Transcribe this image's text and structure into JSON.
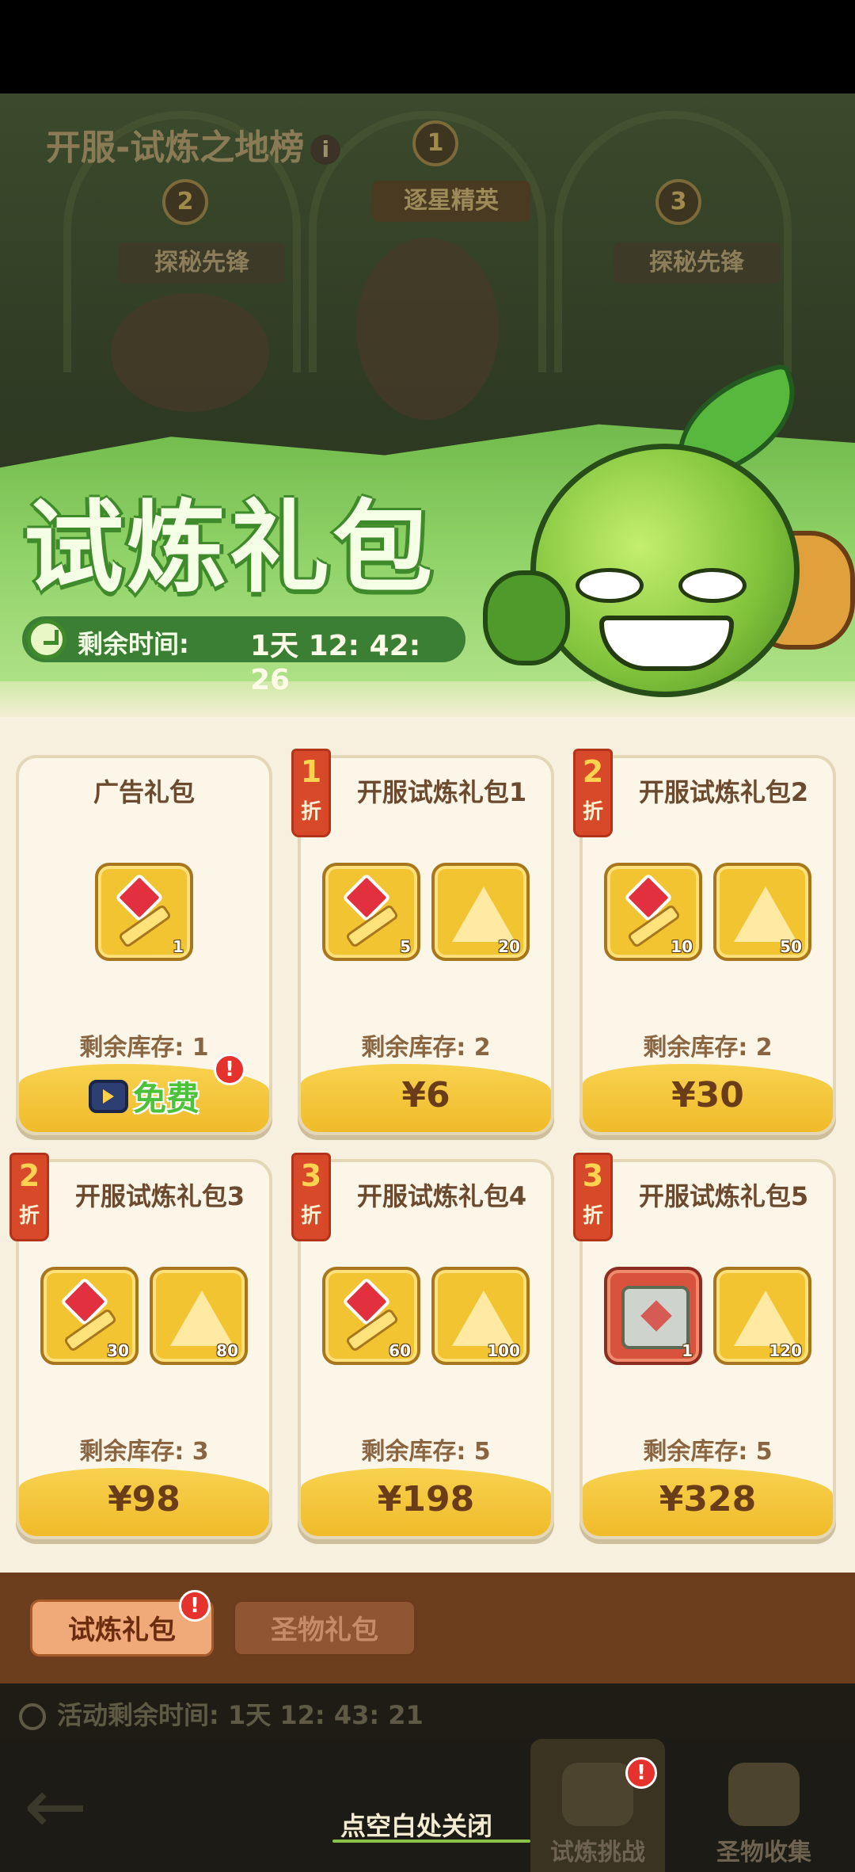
{
  "background": {
    "rank_title": "开服-试炼之地榜",
    "rank_info_icon": "i",
    "rank_badges": [
      "1",
      "2",
      "3"
    ],
    "rank_titles": [
      "逐星精英",
      "探秘先锋",
      "探秘先锋"
    ]
  },
  "banner": {
    "title": "试炼礼包",
    "timer_label": "剩余时间:",
    "timer_value": "1天 12: 42: 26"
  },
  "packs": [
    {
      "name": "广告礼包",
      "discount": "",
      "items": [
        {
          "icon": "red-gem-key-icon",
          "count": "1"
        }
      ],
      "stock": "剩余库存: 1",
      "price": "",
      "free_label": "免费",
      "alert": "!"
    },
    {
      "name": "开服试炼礼包1",
      "discount": "1",
      "items": [
        {
          "icon": "red-gem-key-icon",
          "count": "5"
        },
        {
          "icon": "gold-pyramid-icon",
          "count": "20"
        }
      ],
      "stock": "剩余库存: 2",
      "price": "¥6"
    },
    {
      "name": "开服试炼礼包2",
      "discount": "2",
      "items": [
        {
          "icon": "red-gem-key-icon",
          "count": "10"
        },
        {
          "icon": "gold-pyramid-icon",
          "count": "50"
        }
      ],
      "stock": "剩余库存: 2",
      "price": "¥30"
    },
    {
      "name": "开服试炼礼包3",
      "discount": "2",
      "items": [
        {
          "icon": "red-gem-key-icon",
          "count": "30"
        },
        {
          "icon": "gold-pyramid-icon",
          "count": "80"
        }
      ],
      "stock": "剩余库存: 3",
      "price": "¥98"
    },
    {
      "name": "开服试炼礼包4",
      "discount": "3",
      "items": [
        {
          "icon": "red-gem-key-icon",
          "count": "60"
        },
        {
          "icon": "gold-pyramid-icon",
          "count": "100"
        }
      ],
      "stock": "剩余库存: 5",
      "price": "¥198"
    },
    {
      "name": "开服试炼礼包5",
      "discount": "3",
      "items": [
        {
          "icon": "mystery-chest-icon",
          "count": "1"
        },
        {
          "icon": "gold-pyramid-icon",
          "count": "120"
        }
      ],
      "stock": "剩余库存: 5",
      "price": "¥328"
    }
  ],
  "discount_suffix": "折",
  "tabs": {
    "active": "试炼礼包",
    "inactive": "圣物礼包",
    "active_alert": "!"
  },
  "footer": {
    "activity_time": "活动剩余时间: 1天 12: 43: 21",
    "close_hint": "点空白处关闭",
    "nav_trial": "试炼挑战",
    "nav_relic": "圣物收集",
    "nav_trial_alert": "!"
  },
  "colors": {
    "banner_green": "#8fd267",
    "panel_bg": "#f7f0de",
    "price_gold": "#f8d24f",
    "discount_red": "#d8492a",
    "tabbar_brown": "#6d3e1e"
  }
}
